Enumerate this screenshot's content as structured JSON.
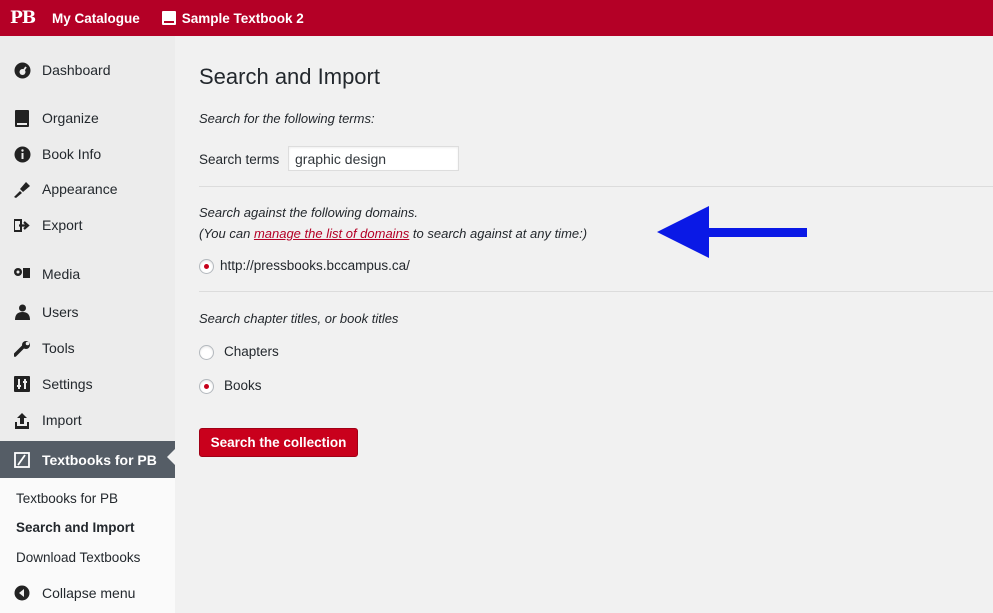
{
  "adminbar": {
    "logo": "PB",
    "catalogue_label": "My Catalogue",
    "book_label": "Sample Textbook 2"
  },
  "sidebar": {
    "items": [
      {
        "label": "Dashboard",
        "icon": "dashboard-icon"
      },
      {
        "label": "Organize",
        "icon": "book-icon"
      },
      {
        "label": "Book Info",
        "icon": "info-icon"
      },
      {
        "label": "Appearance",
        "icon": "brush-icon"
      },
      {
        "label": "Export",
        "icon": "export-icon"
      },
      {
        "label": "Media",
        "icon": "media-icon"
      },
      {
        "label": "Users",
        "icon": "users-icon"
      },
      {
        "label": "Tools",
        "icon": "wrench-icon"
      },
      {
        "label": "Settings",
        "icon": "settings-icon"
      },
      {
        "label": "Import",
        "icon": "upload-icon"
      },
      {
        "label": "Textbooks for PB",
        "icon": "textbook-icon"
      }
    ],
    "submenu": [
      "Textbooks for PB",
      "Search and Import",
      "Download Textbooks"
    ],
    "collapse_label": "Collapse menu"
  },
  "main": {
    "title": "Search and Import",
    "terms_heading": "Search for the following terms:",
    "search_label": "Search terms",
    "search_value": "graphic design",
    "domains_heading": "Search against the following domains.",
    "domains_note_prefix": "(You can ",
    "domains_link": "manage the list of domains",
    "domains_note_suffix": " to search against at any time:)",
    "domain_option": "http://pressbooks.bccampus.ca/",
    "type_heading": "Search chapter titles, or book titles",
    "type_options": [
      "Chapters",
      "Books"
    ],
    "selected_type": "Books",
    "submit_label": "Search the collection"
  },
  "colors": {
    "brand": "#b40026",
    "arrow": "#0a19e6"
  }
}
